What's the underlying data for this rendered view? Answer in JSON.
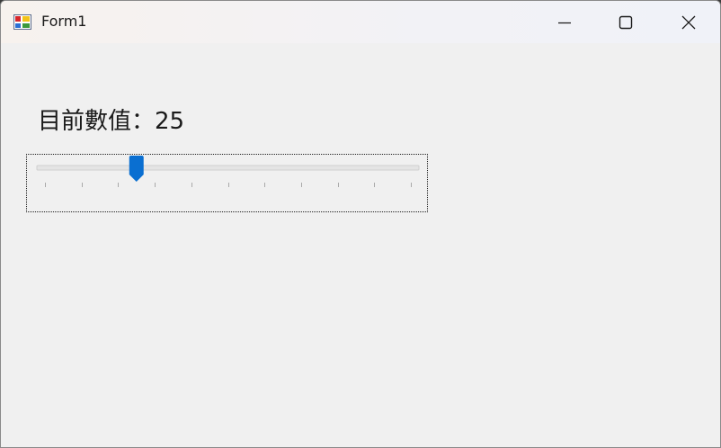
{
  "window": {
    "title": "Form1",
    "icon": "winforms-app-icon",
    "buttons": [
      "minimize-icon",
      "maximize-icon",
      "close-icon"
    ]
  },
  "form": {
    "value_text": "目前數值：25"
  },
  "trackbar": {
    "minimum": 0,
    "maximum": 100,
    "value": 25,
    "tick_frequency": 10,
    "thumb_color": "#0a6fd1"
  }
}
